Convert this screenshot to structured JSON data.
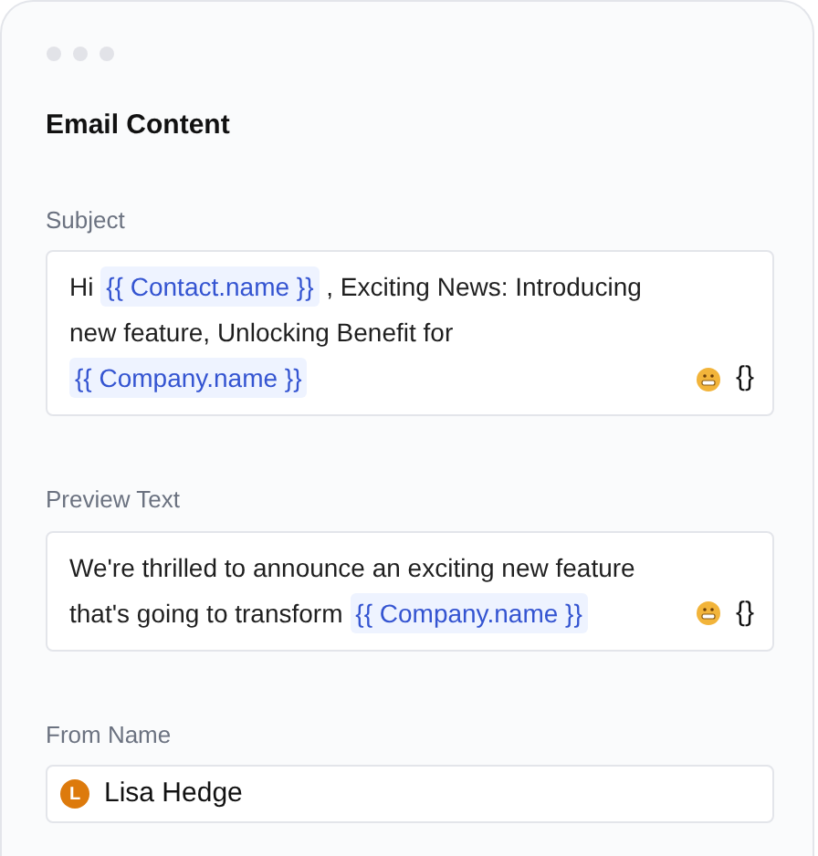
{
  "title": "Email Content",
  "fields": [
    {
      "label": "Subject",
      "kind": "rich",
      "segments": [
        {
          "kind": "text",
          "text": "Hi"
        },
        {
          "kind": "token",
          "text": "{{ Contact.name }}"
        },
        {
          "kind": "text",
          "text": ", Exciting News: Introducing new feature, Unlocking Benefit for"
        },
        {
          "kind": "token",
          "text": "{{ Company.name }}"
        }
      ],
      "variable_button": "{}"
    },
    {
      "label": "Preview Text",
      "kind": "rich",
      "segments": [
        {
          "kind": "text",
          "text": "We're thrilled to announce an exciting new feature that's going to transform"
        },
        {
          "kind": "token",
          "text": "{{ Company.name }}"
        }
      ],
      "variable_button": "{}"
    },
    {
      "label": "From Name",
      "kind": "sender",
      "initial": "L",
      "value": "Lisa Hedge"
    }
  ]
}
